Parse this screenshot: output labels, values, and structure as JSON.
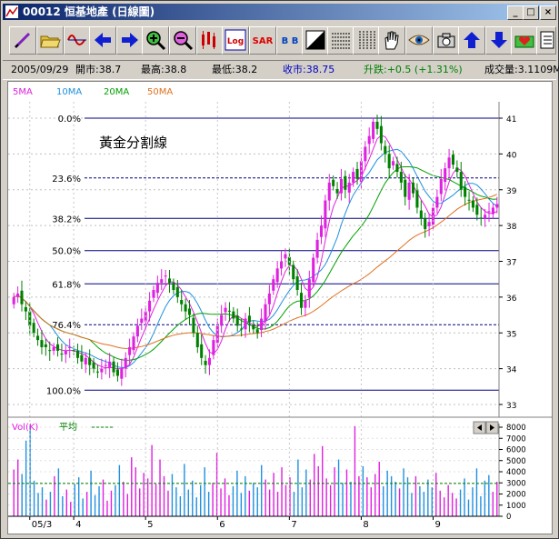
{
  "window": {
    "title": "00012  恒基地產  (日線圖)",
    "min_label": "_",
    "max_label": "□",
    "close_label": "×"
  },
  "toolbar": {
    "icons": [
      "pen-icon",
      "open-folder-icon",
      "wave-icon",
      "arrow-left-icon",
      "arrow-right-icon",
      "zoom-in-icon",
      "zoom-out-icon",
      "candlestick-icon",
      "log-icon",
      "sar-icon",
      "bb-icon",
      "contrast-icon",
      "grid-horizontal-icon",
      "grid-vertical-icon",
      "hand-icon",
      "eye-icon",
      "camera-icon",
      "arrow-up-icon",
      "arrow-down-icon",
      "heart-icon",
      "book-icon"
    ],
    "log_label": "Log",
    "sar_label": "SAR",
    "bb_label": "B B"
  },
  "info": {
    "date": "2005/09/29",
    "open": "開市:38.7",
    "high": "最高:38.8",
    "low": "最低:38.2",
    "close": "收市:38.75",
    "change": "升跌:+0.5 (+1.31%)",
    "volume": "成交量:3.1109M"
  },
  "colors": {
    "ma5": "#e020e0",
    "ma10": "#2090e0",
    "ma20": "#00a000",
    "ma50": "#e07020",
    "up": "#e020e0",
    "down": "#008000",
    "fib": "#000080"
  },
  "chart_data": [
    {
      "type": "candlestick",
      "legend": [
        "5MA",
        "10MA",
        "20MA",
        "50MA"
      ],
      "annotation": "黃金分割線",
      "y_ticks": [
        33,
        34,
        35,
        36,
        37,
        38,
        39,
        40,
        41
      ],
      "ylim": [
        32.6,
        41.6
      ],
      "x_tick_labels": [
        "05/3",
        "4",
        "5",
        "6",
        "7",
        "8",
        "9"
      ],
      "fib_levels": [
        {
          "label": "0.0%",
          "value": 41.0,
          "style": "solid"
        },
        {
          "label": "23.6%",
          "value": 39.33,
          "style": "dashed"
        },
        {
          "label": "38.2%",
          "value": 38.2,
          "style": "solid"
        },
        {
          "label": "50.0%",
          "value": 37.3,
          "style": "solid"
        },
        {
          "label": "61.8%",
          "value": 36.37,
          "style": "solid"
        },
        {
          "label": "76.4%",
          "value": 35.23,
          "style": "dashed"
        },
        {
          "label": "100.0%",
          "value": 33.4,
          "style": "solid"
        }
      ],
      "grid": true,
      "closes": [
        36.0,
        36.1,
        35.8,
        35.6,
        35.2,
        35.0,
        34.8,
        34.6,
        34.6,
        34.5,
        34.6,
        34.5,
        34.4,
        34.5,
        34.6,
        34.5,
        34.3,
        34.2,
        34.3,
        34.1,
        34.0,
        33.9,
        34.0,
        34.1,
        34.2,
        33.9,
        33.8,
        34.0,
        34.3,
        34.6,
        34.9,
        35.2,
        35.4,
        35.6,
        35.9,
        36.2,
        36.4,
        36.5,
        36.6,
        36.4,
        36.2,
        36.0,
        35.8,
        35.6,
        35.5,
        35.0,
        34.6,
        34.3,
        34.1,
        34.3,
        34.8,
        35.2,
        35.5,
        35.7,
        35.6,
        35.4,
        35.2,
        35.1,
        35.4,
        35.3,
        35.1,
        35.0,
        35.4,
        35.8,
        36.1,
        36.5,
        36.8,
        37.0,
        37.2,
        36.9,
        36.5,
        36.2,
        35.7,
        35.9,
        36.5,
        37.1,
        37.6,
        38.0,
        38.7,
        39.2,
        39.1,
        38.9,
        39.3,
        39.0,
        39.2,
        39.5,
        39.3,
        39.8,
        40.2,
        40.5,
        40.9,
        40.7,
        40.3,
        40.0,
        39.6,
        39.8,
        39.5,
        39.2,
        38.8,
        39.2,
        38.9,
        38.5,
        38.2,
        37.9,
        38.1,
        38.5,
        38.8,
        39.3,
        39.6,
        39.9,
        39.7,
        39.5,
        39.0,
        38.8,
        38.7,
        38.5,
        38.3,
        38.2,
        38.3,
        38.4,
        38.5,
        38.6
      ]
    },
    {
      "type": "bar",
      "legend": [
        "Vol(K)",
        "平均"
      ],
      "y_ticks": [
        0,
        1000,
        2000,
        3000,
        4000,
        5000,
        6000,
        7000,
        8000
      ],
      "ylim": [
        0,
        8000
      ],
      "average": 2950,
      "values": [
        4200,
        5100,
        3800,
        6800,
        8200,
        3200,
        2100,
        2600,
        1500,
        2200,
        3600,
        4300,
        1800,
        2400,
        1300,
        2900,
        3500,
        1600,
        2200,
        4100,
        1900,
        2700,
        3300,
        1400,
        2300,
        2800,
        4600,
        3100,
        2000,
        5300,
        4400,
        2500,
        3900,
        3400,
        6400,
        2900,
        5100,
        3600,
        2300,
        3800,
        2600,
        1800,
        4700,
        2400,
        3200,
        1700,
        2800,
        4400,
        2200,
        3000,
        5700,
        2500,
        3400,
        1900,
        2700,
        4100,
        2100,
        3600,
        2300,
        3000,
        2600,
        4600,
        3300,
        2400,
        3900,
        2200,
        4400,
        2800,
        3500,
        2200,
        5100,
        2600,
        4200,
        3300,
        5600,
        4500,
        6300,
        3400,
        2800,
        4400,
        5100,
        3000,
        4200,
        3100,
        8100,
        3600,
        4500,
        3500,
        2600,
        3800,
        4900,
        2700,
        4100,
        3600,
        3100,
        2500,
        4300,
        3500,
        2100,
        3600,
        2700,
        2200,
        3300,
        2600,
        3900,
        2300,
        1700,
        2800,
        2100,
        1600,
        2400,
        3400,
        1500,
        2600,
        4300,
        1800,
        3200,
        3700,
        2200,
        3100
      ]
    }
  ]
}
